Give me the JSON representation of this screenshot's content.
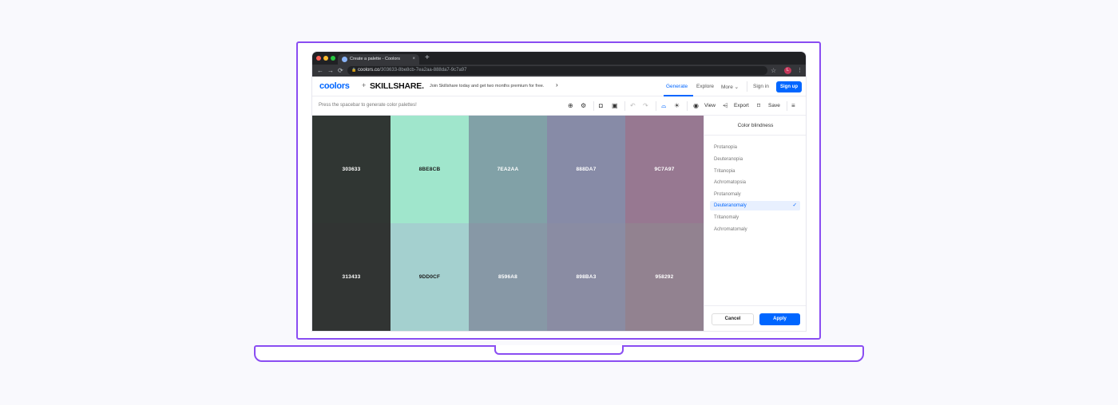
{
  "browser": {
    "tab_title": "Create a palette - Coolors",
    "tab_close": "×",
    "new_tab": "+",
    "url_host": "coolors.co",
    "url_path": "/303633-8be8cb-7ea2aa-888da7-9c7a97",
    "avatar_letter": "L"
  },
  "site_header": {
    "logo": "coolors",
    "plus": "+",
    "partner": "SKILLSHARE.",
    "promo": "Join Skillshare today and get two months premium for free.",
    "nav": {
      "generate": "Generate",
      "explore": "Explore",
      "more": "More",
      "signin": "Sign in",
      "signup": "Sign up"
    }
  },
  "toolbar": {
    "hint": "Press the spacebar to generate color palettes!",
    "view": "View",
    "export": "Export",
    "save": "Save"
  },
  "palette": [
    {
      "top_hex": "303633",
      "top_color": "#303633",
      "top_text": "#ffffff",
      "bottom_hex": "313433",
      "bottom_color": "#313433",
      "bottom_text": "#ffffff"
    },
    {
      "top_hex": "8BE8CB",
      "top_color": "#a0e6cc",
      "top_text": "#1a1a1a",
      "bottom_hex": "9DD0CF",
      "bottom_color": "#a4d0cf",
      "bottom_text": "#1a1a1a"
    },
    {
      "top_hex": "7EA2AA",
      "top_color": "#81a1a7",
      "top_text": "#ffffff",
      "bottom_hex": "8596A8",
      "bottom_color": "#8798a6",
      "bottom_text": "#ffffff"
    },
    {
      "top_hex": "888DA7",
      "top_color": "#878ba7",
      "top_text": "#ffffff",
      "bottom_hex": "898BA3",
      "bottom_color": "#8a8ca3",
      "bottom_text": "#ffffff"
    },
    {
      "top_hex": "9C7A97",
      "top_color": "#977891",
      "top_text": "#ffffff",
      "bottom_hex": "958292",
      "bottom_color": "#928290",
      "bottom_text": "#ffffff"
    }
  ],
  "panel": {
    "title": "Color blindness",
    "options": [
      {
        "label": "Protanopia",
        "selected": false
      },
      {
        "label": "Deuteranopia",
        "selected": false
      },
      {
        "label": "Tritanopia",
        "selected": false
      },
      {
        "label": "Achromatopsia",
        "selected": false
      },
      {
        "label": "Protanomaly",
        "selected": false
      },
      {
        "label": "Deuteranomaly",
        "selected": true
      },
      {
        "label": "Tritanomaly",
        "selected": false
      },
      {
        "label": "Achromatomaly",
        "selected": false
      }
    ],
    "cancel": "Cancel",
    "apply": "Apply"
  },
  "colors": {
    "accent": "#0066ff",
    "frame": "#8a4df2"
  },
  "icons": {
    "back": "←",
    "forward": "→",
    "reload": "⟳",
    "lock": "🔒",
    "star": "☆",
    "kebab": "⋮",
    "promo_arrow": "›",
    "more_chevron": "⌄",
    "adjust": "⊕",
    "settings": "⚙",
    "camera": "◘",
    "sidebar": "▣",
    "undo": "↶",
    "redo": "↷",
    "glasses": "⌓",
    "sun": "☀",
    "eye": "◉",
    "share": "⩤",
    "bookmark": "⌑",
    "menu": "≡",
    "check": "✓"
  }
}
